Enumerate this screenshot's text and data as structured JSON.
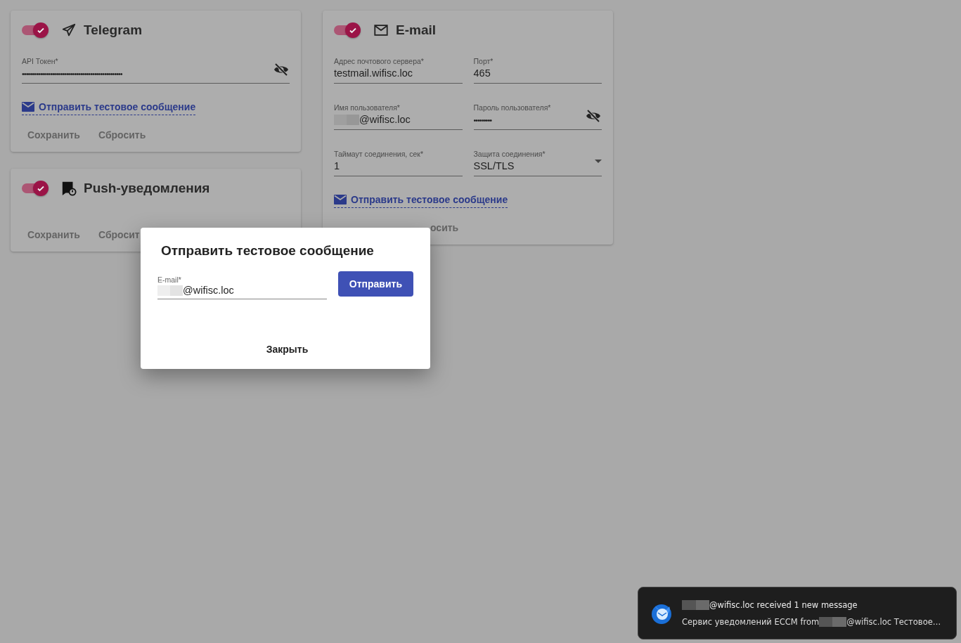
{
  "cards": [
    {
      "kind": "telegram",
      "title": "Telegram",
      "enabled": true,
      "fields": [
        {
          "kind": "password",
          "label": "API Токен*",
          "value": "••••••••••••••••••••••••••••••••••••••••••••••••••"
        }
      ],
      "link": "Отправить тестовое сообщение",
      "buttons": [
        {
          "label": "Сохранить",
          "disabled": true
        },
        {
          "label": "Сбросить",
          "disabled": true
        }
      ]
    },
    {
      "kind": "push",
      "title": "Push-уведомления",
      "enabled": true,
      "buttons": [
        {
          "label": "Сохранить",
          "disabled": true
        },
        {
          "label": "Сбросит",
          "disabled": true
        }
      ]
    },
    {
      "kind": "email",
      "title": "E-mail",
      "enabled": true,
      "fields": [
        {
          "kind": "text",
          "label": "Адрес почтового сервера*",
          "value": "testmail.wifisc.loc"
        },
        {
          "kind": "text",
          "label": "Порт*",
          "value": "465"
        },
        {
          "kind": "redacted",
          "label": "Имя пользователя*",
          "value": "@wifisc.loc"
        },
        {
          "kind": "password",
          "label": "Пароль пользователя*",
          "value": "•••••••••"
        },
        {
          "kind": "text",
          "label": "Таймаут соединения, сек*",
          "value": "1"
        },
        {
          "kind": "select",
          "label": "Защита соединения*",
          "value": "SSL/TLS"
        }
      ],
      "link": "Отправить тестовое сообщение",
      "buttons": [
        {
          "label": "осить",
          "disabled": true
        }
      ]
    }
  ],
  "dialog": {
    "title": "Отправить тестовое сообщение",
    "field": {
      "kind": "redacted",
      "label": "E-mail*",
      "value": "@wifisc.loc"
    },
    "send": "Отправить",
    "close": "Закрыть"
  },
  "notification": {
    "title": "@wifisc.loc received 1 new message",
    "body_start": "Сервис уведомлений ECCM from",
    "body_end": "@wifisc.loc Тестовое…"
  }
}
